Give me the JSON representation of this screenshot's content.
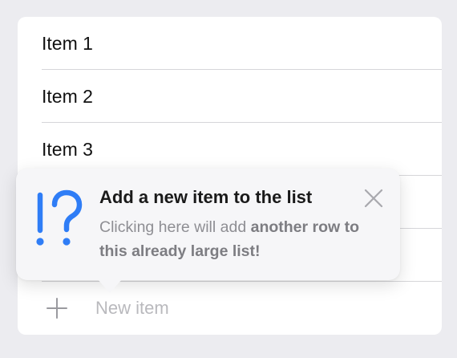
{
  "list": {
    "items": [
      {
        "label": "Item 1"
      },
      {
        "label": "Item 2"
      },
      {
        "label": "Item 3"
      },
      {
        "label": ""
      },
      {
        "label": ""
      }
    ],
    "add_label": "New item"
  },
  "tooltip": {
    "icon": "exclamation-question-icon",
    "title": "Add a new item to the list",
    "body_prefix": "Clicking here will add ",
    "body_emphasis": "another row to this already large list!"
  },
  "colors": {
    "accent": "#2f7df6",
    "background": "#ececf0",
    "card": "#ffffff",
    "tooltip": "#f6f6f8",
    "separator": "#d6d6d9",
    "placeholder": "#b9b9bd"
  }
}
